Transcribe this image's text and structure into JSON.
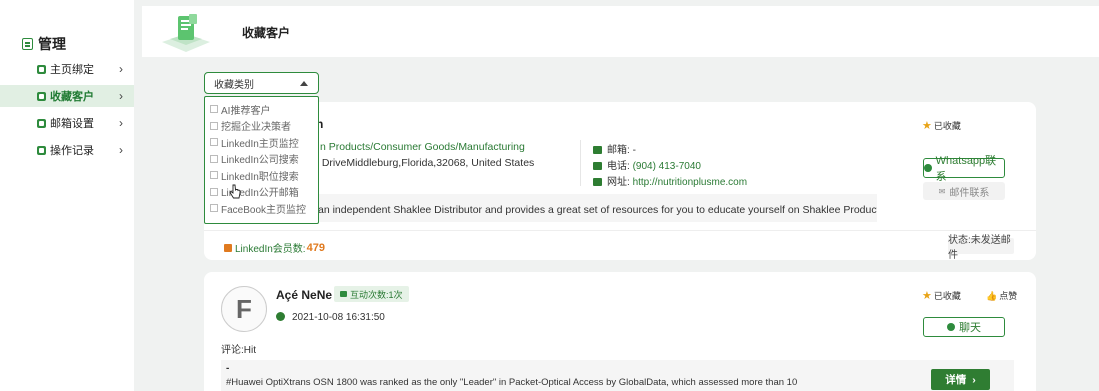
{
  "sidebar": {
    "title": "管理",
    "items": [
      {
        "label": "主页绑定",
        "active": false
      },
      {
        "label": "收藏客户",
        "active": true
      },
      {
        "label": "邮箱设置",
        "active": false
      },
      {
        "label": "操作记录",
        "active": false
      }
    ]
  },
  "header": {
    "title": "收藏客户"
  },
  "filter": {
    "label": "收藏类别",
    "options": [
      "AI推荐客户",
      "挖掘企业决策者",
      "LinkedIn主页监控",
      "LinkedIn公司搜索",
      "LinkedIn职位搜索",
      "LinkedIn公开邮箱",
      "FaceBook主页监控"
    ]
  },
  "card1": {
    "name_partial": "n",
    "industry": "n Products/Consumer Goods/Manufacturing",
    "address": ": DriveMiddleburg,Florida,32068, United States",
    "email_label": "邮箱:",
    "email_value": "-",
    "phone_label": "电话:",
    "phone_value": "(904) 413-7040",
    "website_label": "网址:",
    "website_value": "http://nutritionplusme.com",
    "favorited": "已收藏",
    "whatsapp_button": "Whatsapp联系",
    "mail_button": "邮件联系",
    "description": "an independent Shaklee Distributor and provides a great set of resources for you to educate yourself on Shaklee Products....more",
    "linkedin_label": "LinkedIn会员数:",
    "linkedin_count": "479",
    "status": "状态:未发送邮件"
  },
  "card2": {
    "avatar_letter": "F",
    "name": "Açé NeNe",
    "interactions": "互动次数:1次",
    "datetime": "2021-10-08 16:31:50",
    "comment": "评论:Hit",
    "favorited": "已收藏",
    "like": "点赞",
    "chat_button": "聊天",
    "post_dash": "-",
    "post_text": "#Huawei OptiXtrans OSN 1800 was ranked as the only \"Leader\" in Packet-Optical Access by GlobalData, which assessed more than 10",
    "detail_button": "详情"
  },
  "colors": {
    "accent": "#2e8b3d",
    "linkedin_orange": "#e07a1f",
    "star": "#e8a317"
  }
}
